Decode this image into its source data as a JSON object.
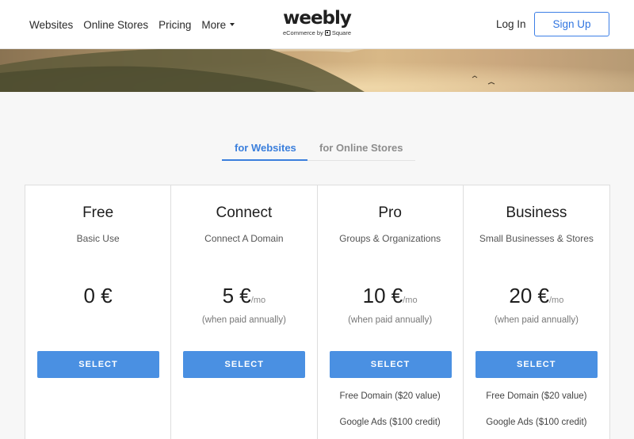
{
  "nav": {
    "links": [
      "Websites",
      "Online Stores",
      "Pricing",
      "More"
    ],
    "login": "Log In",
    "signup": "Sign Up"
  },
  "logo": {
    "word": "weebly",
    "sub_prefix": "eCommerce by",
    "sub_brand": "Square"
  },
  "tabs": {
    "active": "for Websites",
    "inactive": "for Online Stores"
  },
  "plans": [
    {
      "name": "Free",
      "desc": "Basic Use",
      "price": "0 €",
      "per": "",
      "note": "",
      "cta": "SELECT",
      "features": []
    },
    {
      "name": "Connect",
      "desc": "Connect A Domain",
      "price": "5 €",
      "per": "/mo",
      "note": "(when paid annually)",
      "cta": "SELECT",
      "features": []
    },
    {
      "name": "Pro",
      "desc": "Groups & Organizations",
      "price": "10 €",
      "per": "/mo",
      "note": "(when paid annually)",
      "cta": "SELECT",
      "features": [
        "Free Domain ($20 value)",
        "Google Ads ($100 credit)"
      ]
    },
    {
      "name": "Business",
      "desc": "Small Businesses & Stores",
      "price": "20 €",
      "per": "/mo",
      "note": "(when paid annually)",
      "cta": "SELECT",
      "features": [
        "Free Domain ($20 value)",
        "Google Ads ($100 credit)"
      ]
    }
  ],
  "colors": {
    "accent": "#4a90e2",
    "tab_active": "#3b7fdc",
    "tab_inactive": "#8d8d8d"
  }
}
